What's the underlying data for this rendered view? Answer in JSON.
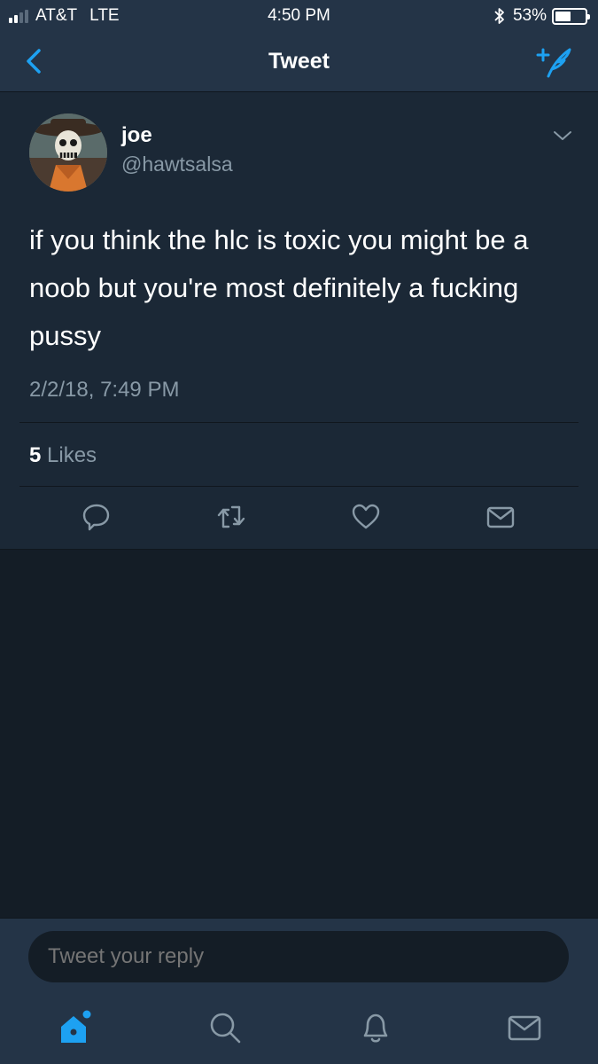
{
  "status": {
    "carrier": "AT&T",
    "network": "LTE",
    "time": "4:50 PM",
    "battery": "53%",
    "battery_level": 0.53
  },
  "nav": {
    "title": "Tweet",
    "back_icon": "chevron-left-icon",
    "compose_icon": "compose-feather-icon"
  },
  "tweet": {
    "author_name": "joe",
    "author_handle": "@hawtsalsa",
    "text": "if you think the hlc is toxic you might be a noob but you're most definitely a fucking pussy",
    "timestamp": "2/2/18, 7:49 PM",
    "likes_count": "5",
    "likes_label": "Likes"
  },
  "actions": [
    "reply-icon",
    "retweet-icon",
    "like-icon",
    "direct-message-icon"
  ],
  "reply": {
    "placeholder": "Tweet your reply"
  },
  "tabs": [
    "home-icon",
    "search-icon",
    "notifications-icon",
    "messages-icon"
  ],
  "colors": {
    "accent": "#1da1f2",
    "background": "#141d26",
    "card": "#1b2836",
    "bar": "#243447",
    "secondary_text": "#8899a6"
  }
}
